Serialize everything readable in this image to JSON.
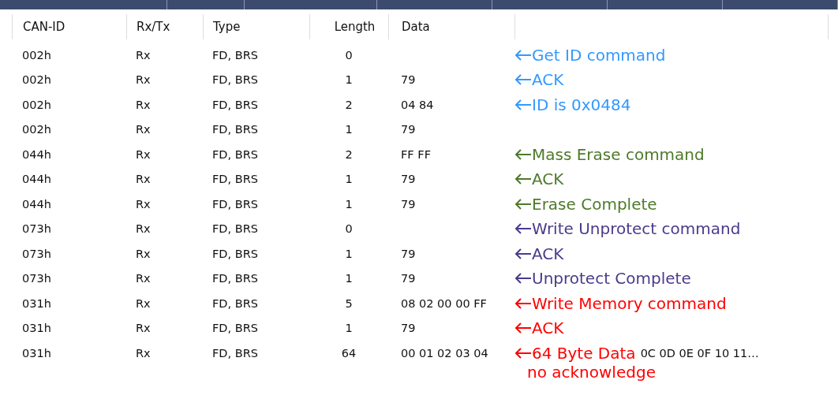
{
  "table": {
    "columns": [
      "CAN-ID",
      "Rx/Tx",
      "Type",
      "Length",
      "Data"
    ],
    "rows": [
      {
        "can_id": "002h",
        "rx_tx": "Rx",
        "type": "FD, BRS",
        "length": "0",
        "data": "",
        "note": {
          "text": "Get ID command",
          "color": "#3399ff"
        }
      },
      {
        "can_id": "002h",
        "rx_tx": "Rx",
        "type": "FD, BRS",
        "length": "1",
        "data": "79",
        "note": {
          "text": "ACK",
          "color": "#3399ff"
        }
      },
      {
        "can_id": "002h",
        "rx_tx": "Rx",
        "type": "FD, BRS",
        "length": "2",
        "data": "04 84",
        "note": {
          "text": "ID is 0x0484",
          "color": "#3399ff"
        }
      },
      {
        "can_id": "002h",
        "rx_tx": "Rx",
        "type": "FD, BRS",
        "length": "1",
        "data": "79"
      },
      {
        "can_id": "044h",
        "rx_tx": "Rx",
        "type": "FD, BRS",
        "length": "2",
        "data": "FF FF",
        "note": {
          "text": "Mass Erase command",
          "color": "#4e7a2a"
        }
      },
      {
        "can_id": "044h",
        "rx_tx": "Rx",
        "type": "FD, BRS",
        "length": "1",
        "data": "79",
        "note": {
          "text": "ACK",
          "color": "#4e7a2a"
        }
      },
      {
        "can_id": "044h",
        "rx_tx": "Rx",
        "type": "FD, BRS",
        "length": "1",
        "data": "79",
        "note": {
          "text": "Erase Complete",
          "color": "#4e7a2a"
        }
      },
      {
        "can_id": "073h",
        "rx_tx": "Rx",
        "type": "FD, BRS",
        "length": "0",
        "data": "",
        "note": {
          "text": "Write Unprotect command",
          "color": "#4b3a8c"
        }
      },
      {
        "can_id": "073h",
        "rx_tx": "Rx",
        "type": "FD, BRS",
        "length": "1",
        "data": "79",
        "note": {
          "text": "ACK",
          "color": "#4b3a8c"
        }
      },
      {
        "can_id": "073h",
        "rx_tx": "Rx",
        "type": "FD, BRS",
        "length": "1",
        "data": "79",
        "note": {
          "text": "Unprotect Complete",
          "color": "#4b3a8c"
        }
      },
      {
        "can_id": "031h",
        "rx_tx": "Rx",
        "type": "FD, BRS",
        "length": "5",
        "data": "08 02 00 00 FF",
        "note": {
          "text": "Write Memory command",
          "color": "#ff0000"
        }
      },
      {
        "can_id": "031h",
        "rx_tx": "Rx",
        "type": "FD, BRS",
        "length": "1",
        "data": "79",
        "note": {
          "text": "ACK",
          "color": "#ff0000"
        }
      },
      {
        "can_id": "031h",
        "rx_tx": "Rx",
        "type": "FD, BRS",
        "length": "64",
        "data": "00 01 02 03 04",
        "data_tail": "0C 0D 0E 0F 10 11…",
        "note": {
          "text": "64 Byte Data",
          "color": "#ff0000"
        }
      }
    ]
  },
  "footnote": {
    "text": "no acknowledge",
    "color": "#ff0000"
  }
}
